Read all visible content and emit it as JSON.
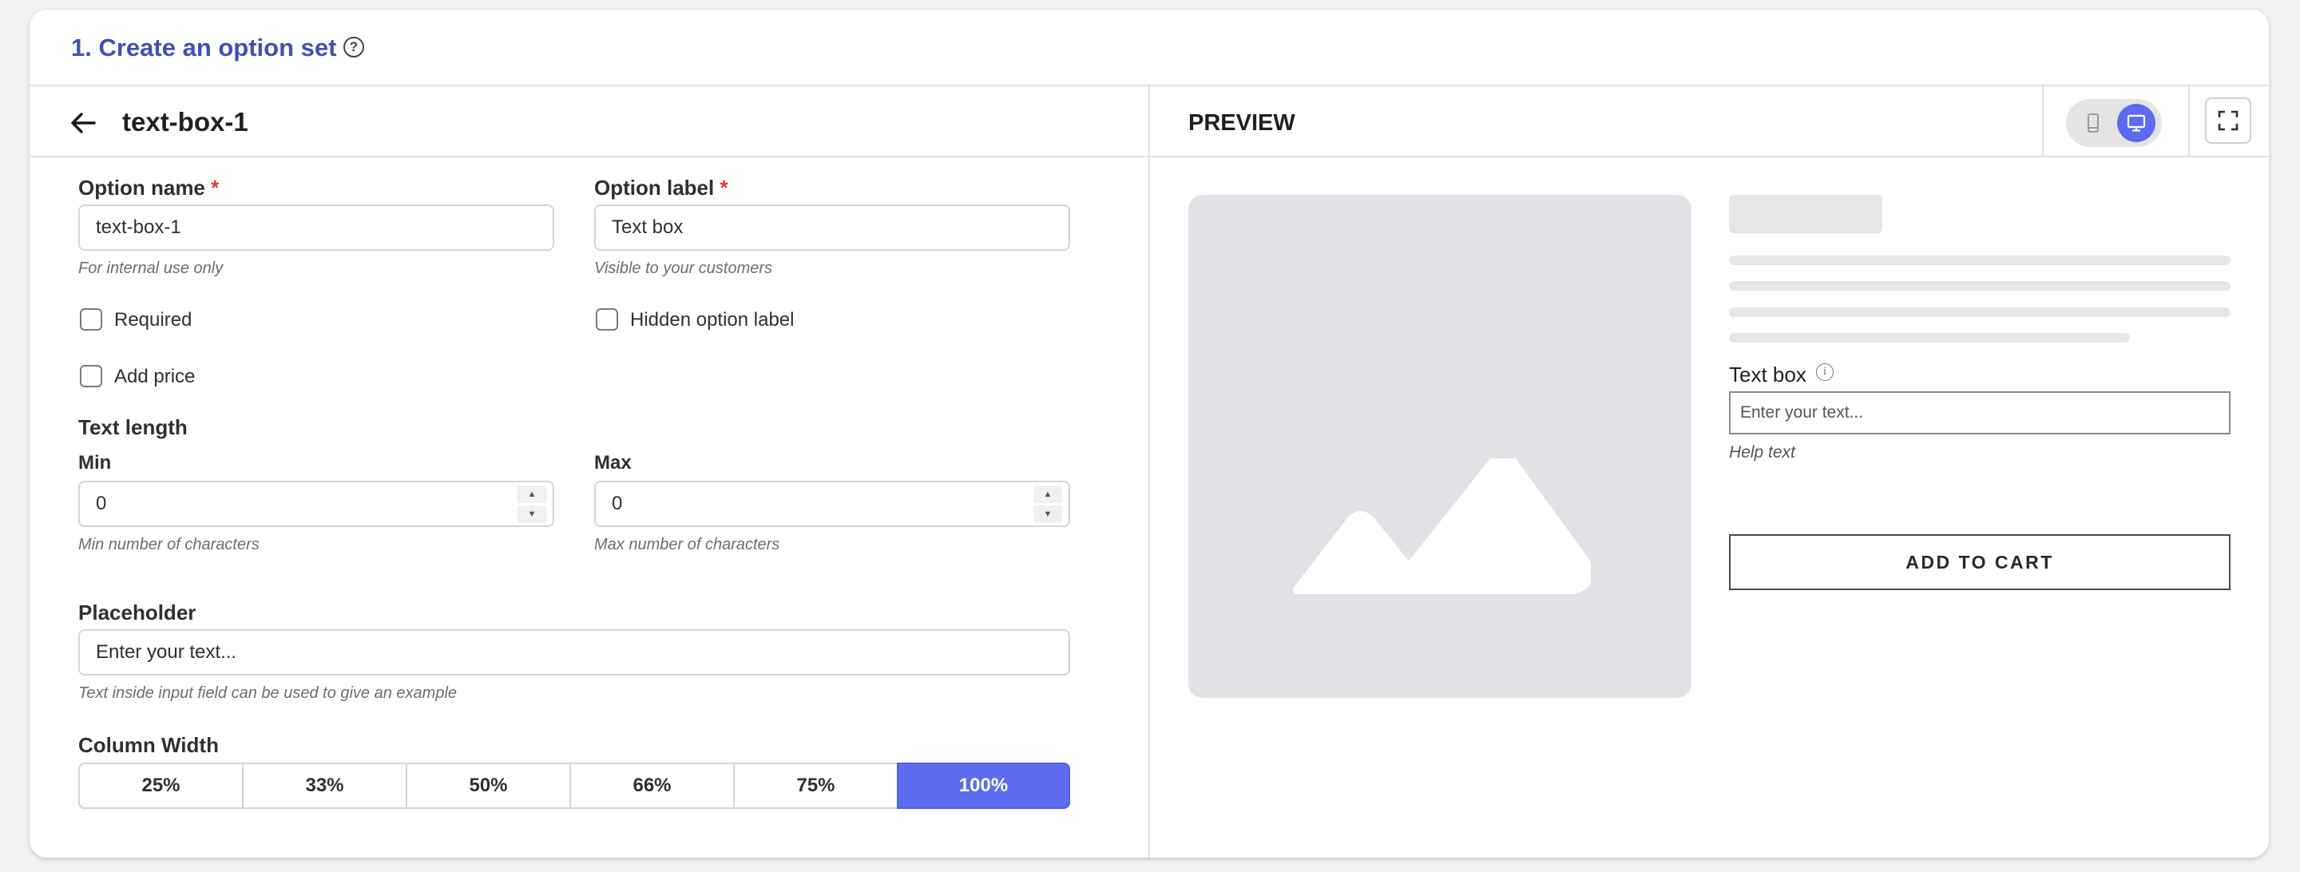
{
  "header": {
    "title": "1. Create an option set",
    "help_icon": "question-circle-icon"
  },
  "option_header": {
    "back_icon": "arrow-left-icon",
    "name": "text-box-1"
  },
  "preview_header": {
    "title": "PREVIEW",
    "device_toggle": {
      "mobile_icon": "mobile-icon",
      "desktop_icon": "desktop-icon",
      "selected": "desktop"
    },
    "expand_icon": "expand-icon"
  },
  "form": {
    "option_name": {
      "label": "Option name",
      "required_mark": "*",
      "value": "text-box-1",
      "hint": "For internal use only"
    },
    "option_label": {
      "label": "Option label",
      "required_mark": "*",
      "value": "Text box",
      "hint": "Visible to your customers"
    },
    "checkboxes": {
      "required": {
        "label": "Required",
        "checked": false
      },
      "hidden_option_label": {
        "label": "Hidden option label",
        "checked": false
      },
      "add_price": {
        "label": "Add price",
        "checked": false
      }
    },
    "text_length": {
      "title": "Text length",
      "min": {
        "label": "Min",
        "value": "0",
        "hint": "Min number of characters"
      },
      "max": {
        "label": "Max",
        "value": "0",
        "hint": "Max number of characters"
      }
    },
    "placeholder": {
      "label": "Placeholder",
      "value": "Enter your text...",
      "hint": "Text inside input field can be used to give an example"
    },
    "column_width": {
      "label": "Column Width",
      "options": [
        "25%",
        "33%",
        "50%",
        "66%",
        "75%",
        "100%"
      ],
      "selected": "100%"
    }
  },
  "preview": {
    "image_icon": "image-placeholder-icon",
    "field_label": "Text box",
    "info_icon": "info-icon",
    "input_placeholder": "Enter your text...",
    "help_text": "Help text",
    "cart_button": "ADD TO CART"
  },
  "colors": {
    "accent": "#5b6cf0",
    "title": "#3f51b5",
    "required": "#e53935"
  }
}
